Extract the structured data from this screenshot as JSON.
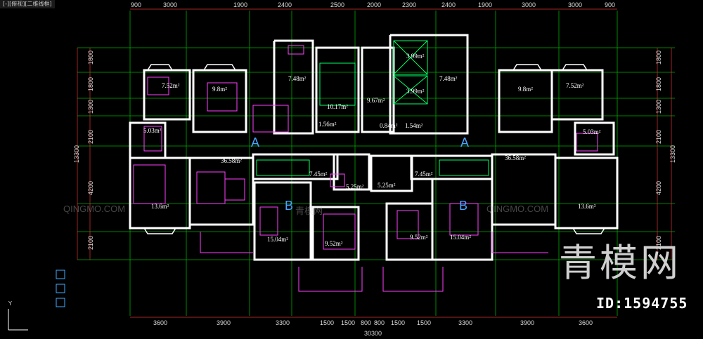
{
  "tab_label": "[-][俯视][二维线框]",
  "dims_top": [
    "900",
    "3000",
    "1900",
    "2400",
    "2500",
    "2000",
    "2300",
    "2400",
    "1900",
    "3000",
    "3000",
    "900"
  ],
  "dims_bottom": [
    "3600",
    "3900",
    "3300",
    "1500",
    "1500",
    "800",
    "800",
    "1500",
    "1500",
    "3300",
    "3900",
    "3600"
  ],
  "dims_left": [
    "1800",
    "1800",
    "1300",
    "2100",
    "4200",
    "2100"
  ],
  "dims_right": [
    "1800",
    "1800",
    "1300",
    "2100",
    "4200",
    "2100"
  ],
  "total_height": "13300",
  "total_width": "30300",
  "rooms": {
    "r1": "7.52m²",
    "r2": "9.8m²",
    "r3": "7.48m²",
    "r4": "10.17m²",
    "r5": "9.67m²",
    "r6": "3.99m²",
    "r7": "3.99m²",
    "r8": "7.48m²",
    "r9": "9.8m²",
    "r10": "7.52m²",
    "r11": "5.03m²",
    "r12": "1.56m²",
    "r13": "0.84m²",
    "r14": "1.54m²",
    "r15": "5.03m²",
    "r16": "36.58m²",
    "r17": "7.45m²",
    "r18": "5.25m²",
    "r19": "5.25m²",
    "r20": "7.45m²",
    "r21": "36.58m²",
    "r22": "13.6m²",
    "r23": "15.04m²",
    "r24": "9.52m²",
    "r25": "9.52m²",
    "r26": "15.04m²",
    "r27": "13.6m²"
  },
  "units": {
    "a_left": "A",
    "a_right": "A",
    "b_left": "B",
    "b_right": "B"
  },
  "watermark": {
    "logo": "青模网",
    "id": "ID:1594755",
    "site": "QINGMO.COM",
    "small_logo": "青模网"
  },
  "axis_label": "Y",
  "colors": {
    "wall": "#ffffff",
    "grid": "#00cc00",
    "furniture": "#ff40ff",
    "dim": "#ff5555",
    "stair": "#00ff66"
  }
}
